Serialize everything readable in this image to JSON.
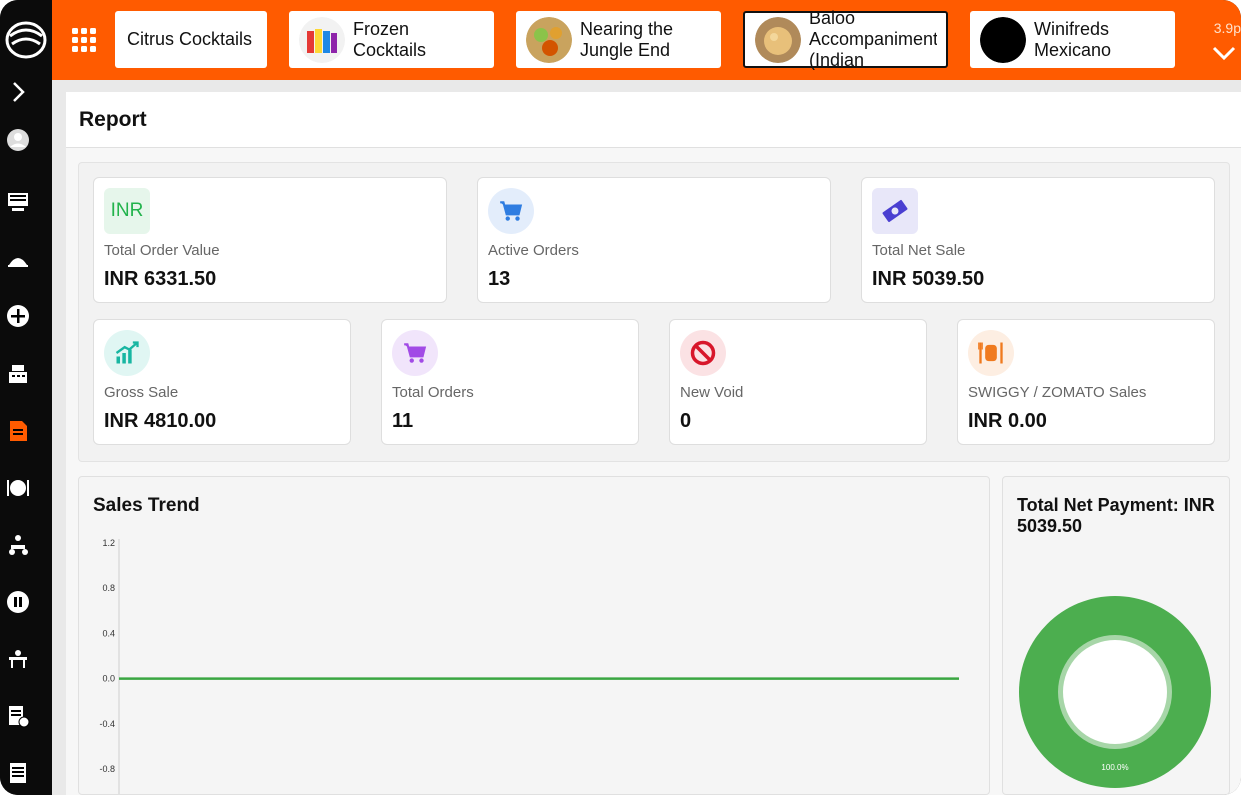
{
  "topbar": {
    "categories": [
      {
        "label": "Citrus Cocktails"
      },
      {
        "label": "Frozen Cocktails"
      },
      {
        "label": "Nearing the Jungle End"
      },
      {
        "label": "Baloo Accompaniments (Indian"
      },
      {
        "label": "Winifreds Mexicano"
      }
    ],
    "right_text": "3.9p"
  },
  "report": {
    "title": "Report"
  },
  "stats": [
    {
      "icon": "inr-icon",
      "icon_text": "INR",
      "caption": "Total Order Value",
      "value": "INR  6331.50",
      "color": "#22b34c"
    },
    {
      "icon": "cart-icon",
      "caption": "Active Orders",
      "value": "13",
      "color": "#2f7de1"
    },
    {
      "icon": "money-icon",
      "caption": "Total Net Sale",
      "value": "INR  5039.50",
      "color": "#4a3fd1"
    },
    {
      "icon": "trend-up-icon",
      "caption": "Gross Sale",
      "value": "INR  4810.00",
      "color": "#18b6a2"
    },
    {
      "icon": "cart-icon",
      "caption": "Total Orders",
      "value": "11",
      "color": "#a24be6"
    },
    {
      "icon": "void-icon",
      "caption": "New Void",
      "value": "0",
      "color": "#d8172b"
    },
    {
      "icon": "dining-icon",
      "caption": "SWIGGY / ZOMATO Sales",
      "value": "INR  0.00",
      "color": "#f07a1e"
    }
  ],
  "sales_trend": {
    "title": "Sales Trend"
  },
  "payment": {
    "title": "Total Net Payment: INR 5039.50",
    "slice_label": "100.0%"
  },
  "chart_data": [
    {
      "type": "line",
      "title": "Sales Trend",
      "yticks": [
        1.2,
        0.8,
        0.4,
        0.0,
        -0.4,
        -0.8
      ],
      "ylim": [
        -0.8,
        1.2
      ],
      "series": [
        {
          "values": [
            0,
            0
          ]
        }
      ],
      "color": "#3aa642"
    },
    {
      "type": "pie",
      "title": "Total Net Payment: INR 5039.50",
      "values": [
        100.0
      ],
      "labels": [
        "100.0%"
      ],
      "color": "#4cae4f"
    }
  ]
}
